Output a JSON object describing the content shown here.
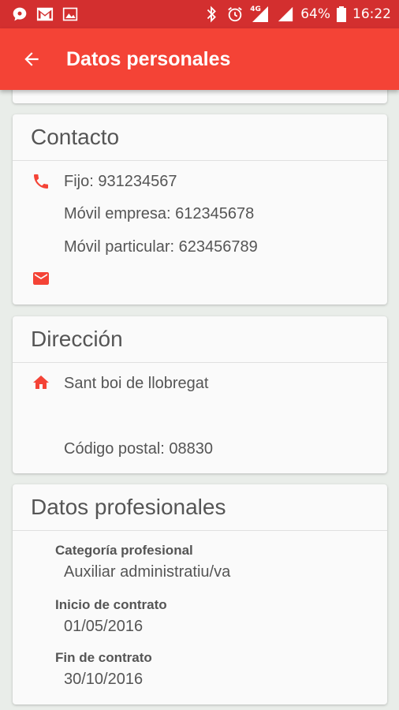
{
  "status_bar": {
    "battery": "64%",
    "time": "16:22",
    "network": "4G",
    "icons": [
      "chat-icon",
      "gmail-icon",
      "image-icon",
      "bluetooth-icon",
      "alarm-icon",
      "mobile-signal-icon",
      "wifi-icon",
      "battery-icon"
    ]
  },
  "app_bar": {
    "title": "Datos personales",
    "back_icon": "arrow-back-icon",
    "color": "#f44336",
    "status_color": "#d32f2f"
  },
  "contact": {
    "title": "Contacto",
    "phone_icon": "phone-icon",
    "mail_icon": "mail-icon",
    "fixed": "Fijo: 931234567",
    "mobile_company": "Móvil empresa: 612345678",
    "mobile_private": "Móvil particular: 623456789",
    "email": ""
  },
  "address": {
    "title": "Dirección",
    "home_icon": "home-icon",
    "city": "Sant boi de llobregat",
    "postal_code": "Código postal: 08830"
  },
  "professional": {
    "title": "Datos profesionales",
    "category_label": "Categoría profesional",
    "category_value": "Auxiliar administratiu/va",
    "start_label": "Inicio de contrato",
    "start_value": "01/05/2016",
    "end_label": "Fin de contrato",
    "end_value": "30/10/2016"
  }
}
